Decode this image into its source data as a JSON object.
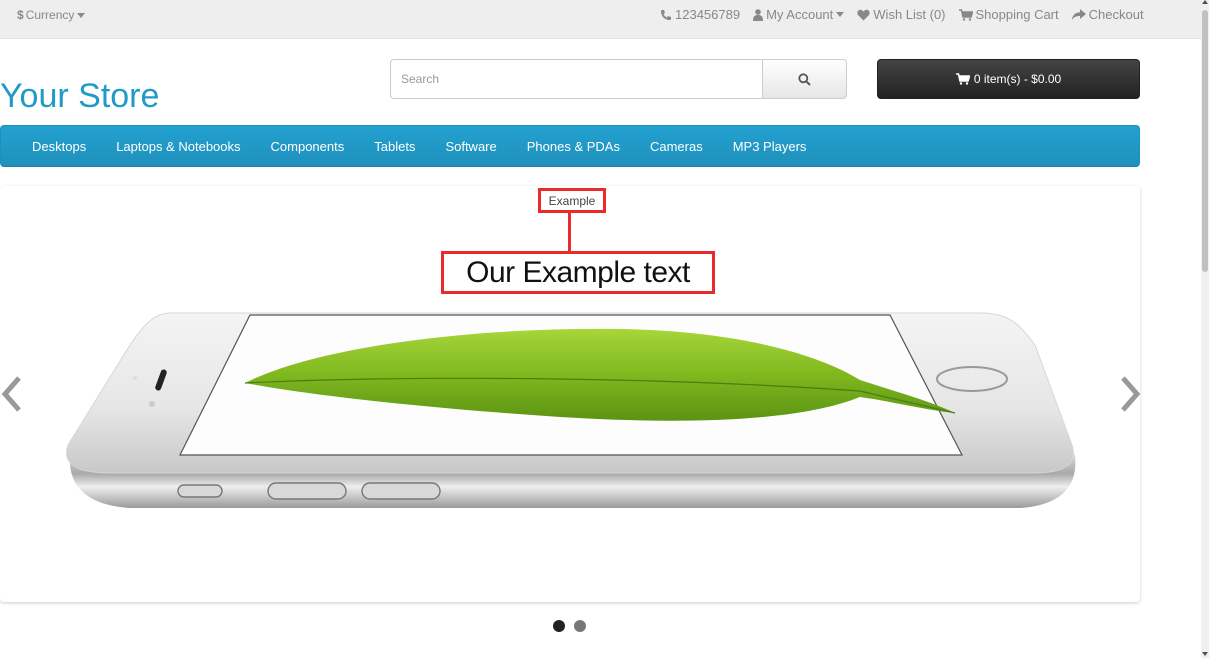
{
  "topbar": {
    "currency_symbol": "$",
    "currency_label": "Currency",
    "phone": "123456789",
    "my_account": "My Account",
    "wish_list": "Wish List (0)",
    "shopping_cart": "Shopping Cart",
    "checkout": "Checkout"
  },
  "header": {
    "logo": "Your Store",
    "search_placeholder": "Search",
    "cart_label": "0 item(s) - $0.00"
  },
  "menu": {
    "items": [
      {
        "label": "Desktops"
      },
      {
        "label": "Laptops & Notebooks"
      },
      {
        "label": "Components"
      },
      {
        "label": "Tablets"
      },
      {
        "label": "Software"
      },
      {
        "label": "Phones & PDAs"
      },
      {
        "label": "Cameras"
      },
      {
        "label": "MP3 Players"
      }
    ]
  },
  "slideshow": {
    "label": "Example",
    "heading": "Our Example text",
    "active_slide": 1,
    "slide_count": 2
  },
  "colors": {
    "brand": "#229ac8",
    "highlight_box": "#ea2b2b",
    "cart_bg": "#303030"
  },
  "icons": [
    "dollar-icon",
    "phone-icon",
    "user-icon",
    "heart-icon",
    "shopping-cart-icon",
    "share-icon",
    "search-icon",
    "chevron-left-icon",
    "chevron-right-icon"
  ]
}
